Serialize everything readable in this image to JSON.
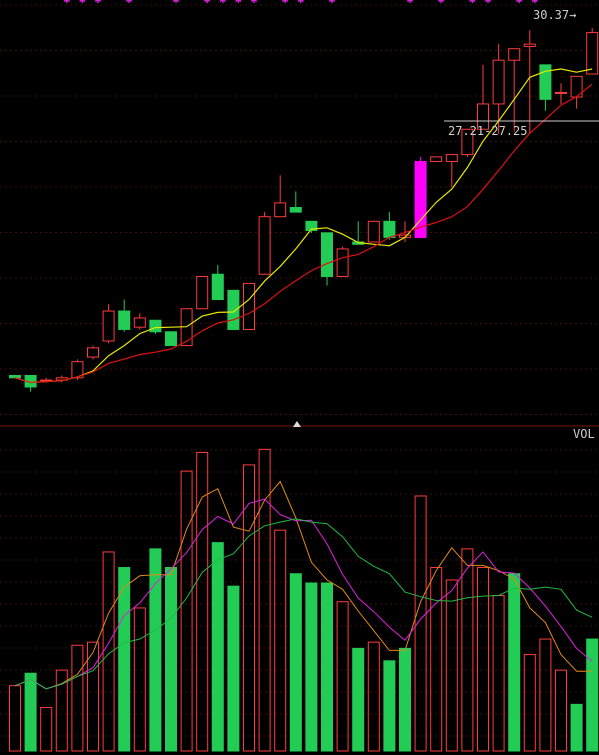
{
  "chart_data": [
    {
      "type": "candlestick",
      "title": "",
      "y_range": [
        22.2,
        31.0
      ],
      "grid": true,
      "colors": {
        "up": "#ff3b3b",
        "down": "#22cc55",
        "limit_up": "#ff00ff",
        "ma_short": "#e8e800",
        "ma_long": "#dd1111",
        "grid": "#3a0f0f"
      },
      "x": [
        "1",
        "2",
        "3",
        "4",
        "5",
        "6",
        "7",
        "8",
        "9",
        "10",
        "11",
        "12",
        "13",
        "14",
        "15",
        "16",
        "17",
        "18",
        "19",
        "20",
        "21",
        "22",
        "23",
        "24",
        "25",
        "26",
        "27",
        "28",
        "29",
        "30",
        "31",
        "32",
        "33",
        "34",
        "35",
        "36",
        "37",
        "38"
      ],
      "candles": [
        {
          "o": 22.95,
          "h": 22.95,
          "l": 22.9,
          "c": 22.9
        },
        {
          "o": 22.95,
          "h": 22.95,
          "l": 22.6,
          "c": 22.7
        },
        {
          "o": 22.85,
          "h": 22.9,
          "l": 22.8,
          "c": 22.85
        },
        {
          "o": 22.85,
          "h": 22.95,
          "l": 22.8,
          "c": 22.9
        },
        {
          "o": 22.9,
          "h": 23.3,
          "l": 22.85,
          "c": 23.25
        },
        {
          "o": 23.35,
          "h": 23.6,
          "l": 23.3,
          "c": 23.55
        },
        {
          "o": 23.7,
          "h": 24.5,
          "l": 23.65,
          "c": 24.35
        },
        {
          "o": 24.35,
          "h": 24.6,
          "l": 23.9,
          "c": 23.95
        },
        {
          "o": 24.0,
          "h": 24.3,
          "l": 23.95,
          "c": 24.2
        },
        {
          "o": 24.15,
          "h": 24.15,
          "l": 23.85,
          "c": 23.9
        },
        {
          "o": 23.9,
          "h": 23.9,
          "l": 23.6,
          "c": 23.6
        },
        {
          "o": 23.6,
          "h": 24.4,
          "l": 23.6,
          "c": 24.4
        },
        {
          "o": 24.4,
          "h": 25.1,
          "l": 24.4,
          "c": 25.1
        },
        {
          "o": 25.15,
          "h": 25.35,
          "l": 24.6,
          "c": 24.6
        },
        {
          "o": 24.8,
          "h": 24.8,
          "l": 23.95,
          "c": 23.95
        },
        {
          "o": 23.95,
          "h": 24.95,
          "l": 23.95,
          "c": 24.95
        },
        {
          "o": 25.15,
          "h": 26.5,
          "l": 25.15,
          "c": 26.4
        },
        {
          "o": 26.4,
          "h": 27.3,
          "l": 26.4,
          "c": 26.7
        },
        {
          "o": 26.6,
          "h": 26.95,
          "l": 26.5,
          "c": 26.5
        },
        {
          "o": 26.3,
          "h": 26.3,
          "l": 26.05,
          "c": 26.1
        },
        {
          "o": 26.05,
          "h": 26.05,
          "l": 24.9,
          "c": 25.1
        },
        {
          "o": 25.1,
          "h": 25.75,
          "l": 25.1,
          "c": 25.7
        },
        {
          "o": 25.85,
          "h": 26.3,
          "l": 25.8,
          "c": 25.8
        },
        {
          "o": 25.85,
          "h": 26.3,
          "l": 25.85,
          "c": 26.3
        },
        {
          "o": 26.3,
          "h": 26.5,
          "l": 25.9,
          "c": 25.95
        },
        {
          "o": 25.95,
          "h": 26.3,
          "l": 25.85,
          "c": 26.0
        },
        {
          "o": 25.95,
          "h": 27.7,
          "l": 25.95,
          "c": 27.6
        },
        {
          "o": 27.6,
          "h": 27.7,
          "l": 27.6,
          "c": 27.7
        },
        {
          "o": 27.6,
          "h": 27.75,
          "l": 27.05,
          "c": 27.75
        },
        {
          "o": 27.75,
          "h": 28.2,
          "l": 27.7,
          "c": 28.3
        },
        {
          "o": 28.3,
          "h": 29.7,
          "l": 28.3,
          "c": 28.85
        },
        {
          "o": 28.85,
          "h": 30.15,
          "l": 28.2,
          "c": 29.8
        },
        {
          "o": 29.8,
          "h": 30.0,
          "l": 28.25,
          "c": 30.05
        },
        {
          "o": 30.1,
          "h": 30.45,
          "l": 28.2,
          "c": 30.15
        },
        {
          "o": 29.7,
          "h": 29.7,
          "l": 28.7,
          "c": 28.95
        },
        {
          "o": 29.1,
          "h": 29.3,
          "l": 28.85,
          "c": 29.1
        },
        {
          "o": 29.0,
          "h": 29.45,
          "l": 28.75,
          "c": 29.45
        },
        {
          "o": 29.5,
          "h": 30.5,
          "l": 29.5,
          "c": 30.4
        }
      ],
      "annotations": [
        {
          "text": "30.37",
          "arrow": "→",
          "near": "high"
        },
        {
          "text": "27.21-27.25",
          "near": "recent gap"
        }
      ]
    },
    {
      "type": "bar",
      "title": "VOL",
      "y_range": [
        0,
        100
      ],
      "x": [
        "1",
        "2",
        "3",
        "4",
        "5",
        "6",
        "7",
        "8",
        "9",
        "10",
        "11",
        "12",
        "13",
        "14",
        "15",
        "16",
        "17",
        "18",
        "19",
        "20",
        "21",
        "22",
        "23",
        "24",
        "25",
        "26",
        "27",
        "28",
        "29",
        "30",
        "31",
        "32",
        "33",
        "34",
        "35",
        "36",
        "37",
        "38"
      ],
      "volume": [
        {
          "v": 21,
          "up": true
        },
        {
          "v": 25,
          "up": false
        },
        {
          "v": 14,
          "up": true
        },
        {
          "v": 26,
          "up": true
        },
        {
          "v": 34,
          "up": true
        },
        {
          "v": 35,
          "up": true
        },
        {
          "v": 64,
          "up": true
        },
        {
          "v": 59,
          "up": false
        },
        {
          "v": 46,
          "up": true
        },
        {
          "v": 65,
          "up": false
        },
        {
          "v": 59,
          "up": false
        },
        {
          "v": 90,
          "up": true
        },
        {
          "v": 96,
          "up": true
        },
        {
          "v": 67,
          "up": false
        },
        {
          "v": 53,
          "up": false
        },
        {
          "v": 92,
          "up": true
        },
        {
          "v": 97,
          "up": true
        },
        {
          "v": 71,
          "up": true
        },
        {
          "v": 57,
          "up": false
        },
        {
          "v": 54,
          "up": false
        },
        {
          "v": 54,
          "up": false
        },
        {
          "v": 48,
          "up": true
        },
        {
          "v": 33,
          "up": false
        },
        {
          "v": 35,
          "up": true
        },
        {
          "v": 29,
          "up": false
        },
        {
          "v": 33,
          "up": false
        },
        {
          "v": 82,
          "up": true
        },
        {
          "v": 59,
          "up": true
        },
        {
          "v": 55,
          "up": true
        },
        {
          "v": 65,
          "up": true
        },
        {
          "v": 59,
          "up": true
        },
        {
          "v": 50,
          "up": true
        },
        {
          "v": 57,
          "up": false
        },
        {
          "v": 31,
          "up": true
        },
        {
          "v": 36,
          "up": true
        },
        {
          "v": 26,
          "up": true
        },
        {
          "v": 15,
          "up": false
        },
        {
          "v": 36,
          "up": false
        }
      ],
      "ma_colors": [
        "#e08a1a",
        "#e020e0",
        "#22bb44"
      ]
    }
  ]
}
